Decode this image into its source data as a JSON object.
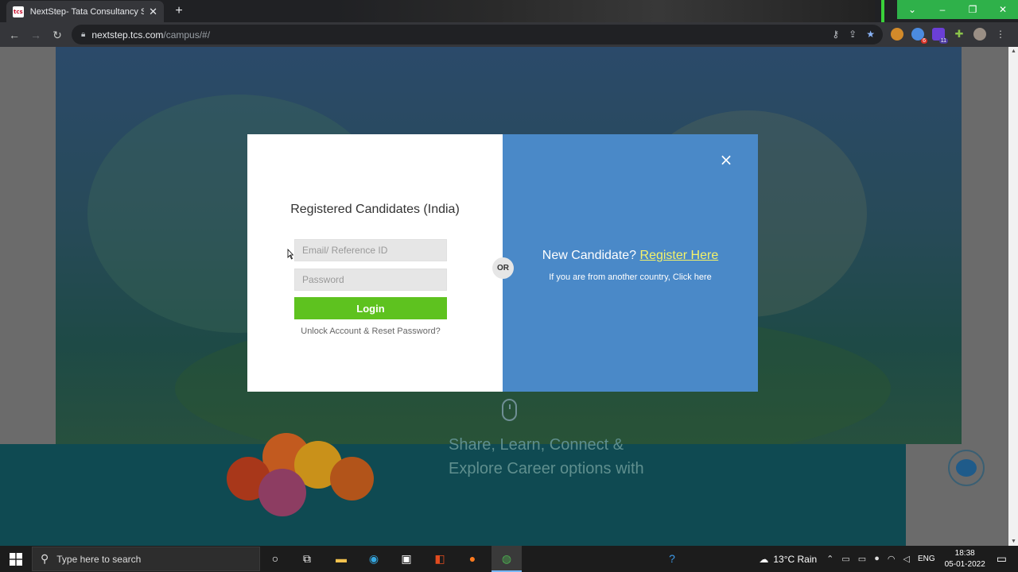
{
  "browser": {
    "tab_title": "NextStep- Tata Consultancy Serv",
    "favicon_text": "tcs",
    "url_host": "nextstep.tcs.com",
    "url_path": "/campus/#/",
    "window_controls": [
      "chevron-down-icon",
      "minimize-icon",
      "maximize-icon",
      "close-icon"
    ],
    "extension_badges": [
      "6",
      "11"
    ]
  },
  "modal": {
    "login_title": "Registered Candidates (India)",
    "email_placeholder": "Email/ Reference ID",
    "password_placeholder": "Password",
    "login_label": "Login",
    "unlock_label": "Unlock Account & Reset Password?",
    "or_label": "OR",
    "new_candidate_label": "New Candidate?",
    "register_label": "Register Here",
    "other_country_label": "If you are from another country, Click here",
    "close_glyph": "×",
    "colors": {
      "left_bg": "#ffffff",
      "right_bg": "#4a89c8",
      "login_btn": "#5ec21f",
      "register_link": "#f5f36a"
    }
  },
  "page": {
    "band_line1": "Share, Learn, Connect &",
    "band_line2": "Explore Career options with"
  },
  "taskbar": {
    "search_placeholder": "Type here to search",
    "weather": "13°C  Rain",
    "language": "ENG",
    "time": "18:38",
    "date": "05-01-2022"
  }
}
